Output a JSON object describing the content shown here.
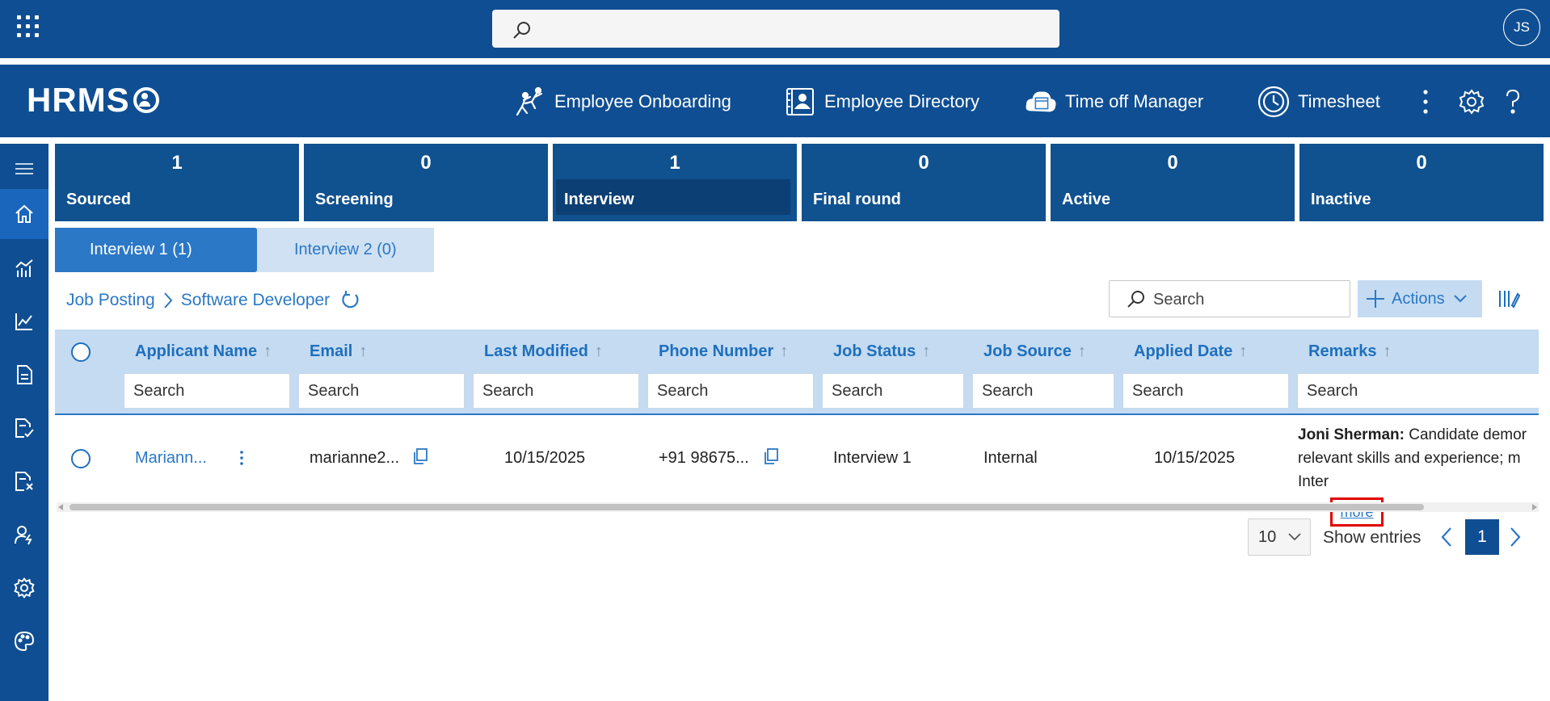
{
  "suite_bar": {
    "user_initials": "JS",
    "search_placeholder": ""
  },
  "app": {
    "logo_text": "HRMS",
    "nav": [
      {
        "label": "Employee Onboarding",
        "icon": "climbing-people-icon"
      },
      {
        "label": "Employee Directory",
        "icon": "directory-book-icon"
      },
      {
        "label": "Time off Manager",
        "icon": "calendar-cloud-icon"
      },
      {
        "label": "Timesheet",
        "icon": "clock-icon"
      }
    ],
    "header_icons": [
      "more-vertical-icon",
      "settings-gear-icon",
      "help-question-icon"
    ]
  },
  "rail": {
    "items": [
      "menu-hamburger-icon",
      "home-icon",
      "analytics-chart-icon",
      "line-chart-icon",
      "document-icon",
      "document-check-icon",
      "document-cancel-icon",
      "person-lightning-icon",
      "settings-icon",
      "palette-icon"
    ],
    "active_index": 1
  },
  "stages": [
    {
      "count": "1",
      "label": "Sourced"
    },
    {
      "count": "0",
      "label": "Screening"
    },
    {
      "count": "1",
      "label": "Interview"
    },
    {
      "count": "0",
      "label": "Final round"
    },
    {
      "count": "0",
      "label": "Active"
    },
    {
      "count": "0",
      "label": "Inactive"
    }
  ],
  "selected_stage": "Interview",
  "subtabs": [
    {
      "label": "Interview 1 (1)"
    },
    {
      "label": "Interview 2 (0)"
    }
  ],
  "breadcrumb": {
    "root": "Job Posting",
    "current": "Software Developer"
  },
  "toolbar": {
    "search_placeholder": "Search",
    "actions_label": "Actions"
  },
  "grid": {
    "columns": [
      {
        "label": "Applicant Name",
        "arrow": "↑",
        "filter_placeholder": "Search"
      },
      {
        "label": "Email",
        "arrow": "↑",
        "filter_placeholder": "Search"
      },
      {
        "label": "Last Modified",
        "arrow": "↑",
        "filter_placeholder": "Search"
      },
      {
        "label": "Phone Number",
        "arrow": "↑",
        "filter_placeholder": "Search"
      },
      {
        "label": "Job Status",
        "arrow": "↑",
        "filter_placeholder": "Search"
      },
      {
        "label": "Job Source",
        "arrow": "↑",
        "filter_placeholder": "Search"
      },
      {
        "label": "Applied Date",
        "arrow": "↑",
        "filter_placeholder": "Search"
      },
      {
        "label": "Remarks",
        "arrow": "↑",
        "filter_placeholder": "Search"
      }
    ],
    "rows": [
      {
        "applicant_name": "Mariann...",
        "email": "marianne2...",
        "last_modified": "10/15/2025",
        "phone_number": "+91 98675...",
        "job_status": "Interview 1",
        "job_source": "Internal",
        "applied_date": "10/15/2025",
        "remarks_author": "Joni Sherman:",
        "remarks_line1": "Candidate demor",
        "remarks_line2": "relevant skills and experience; m",
        "remarks_line3": "Inter",
        "more_label": "more"
      }
    ]
  },
  "pagination": {
    "page_size": "10",
    "show_entries_label": "Show entries",
    "current_page": "1"
  },
  "colors": {
    "brand": "#0f4e92",
    "accent": "#2b78c6",
    "header_bg": "#c4dbf1",
    "highlight_box": "#e00000"
  }
}
